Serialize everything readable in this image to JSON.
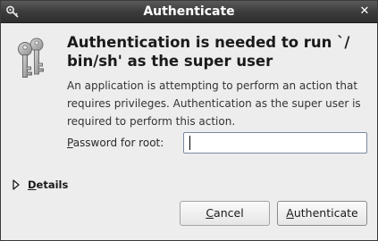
{
  "window": {
    "title": "Authenticate",
    "close_glyph": "✕"
  },
  "icons": {
    "title": "key-icon",
    "main": "keys-icon",
    "details": "expander-right-icon"
  },
  "dialog": {
    "heading": "Authentication is needed to run `/ bin/sh' as the super user",
    "message": "An application is attempting to perform an action that requires privileges. Authentication as the super user is required to perform this action.",
    "password_label_mnemonic": "P",
    "password_label_rest": "assword for root:",
    "password_value": ""
  },
  "details": {
    "label_mnemonic": "D",
    "label_rest": "etails",
    "expanded": false
  },
  "buttons": {
    "cancel_mnemonic": "C",
    "cancel_rest": "ancel",
    "authenticate_mnemonic": "A",
    "authenticate_rest": "uthenticate"
  },
  "colors": {
    "titlebar": "#3c3c3c",
    "dialog_bg": "#ededed",
    "input_border": "#7a8aa0"
  }
}
